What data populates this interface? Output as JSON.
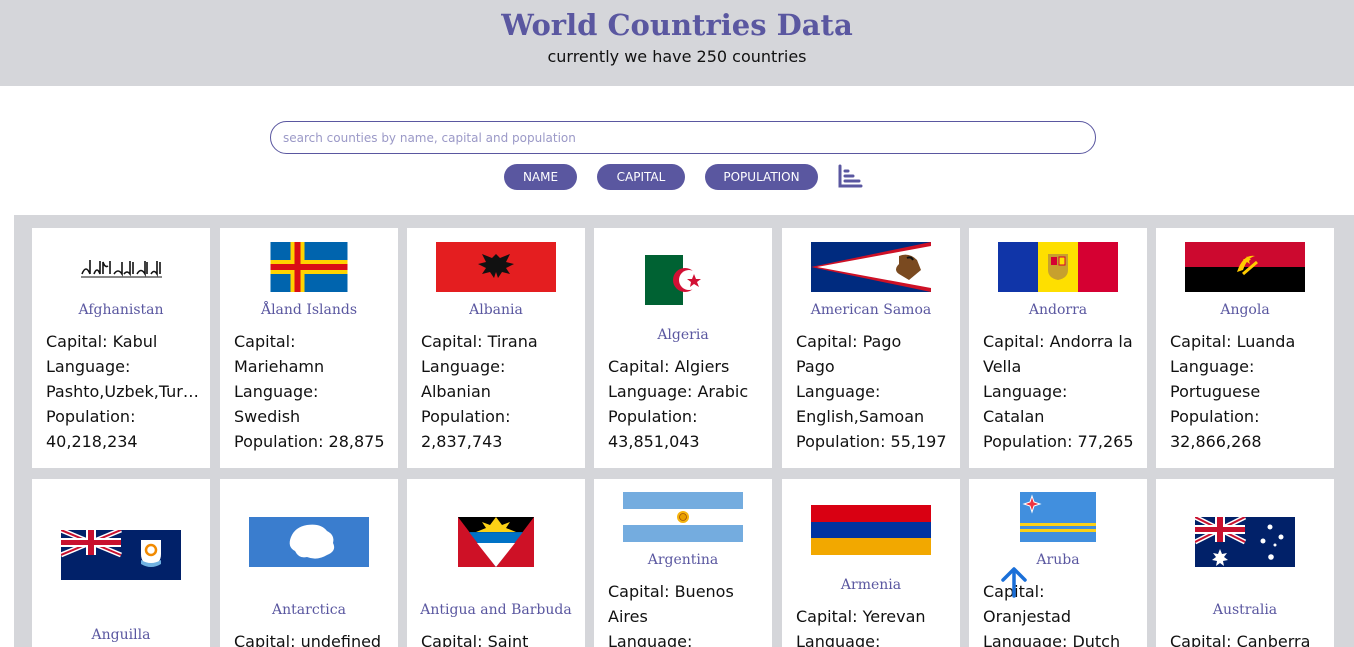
{
  "header": {
    "title": "World Countries Data",
    "subtitle": "currently we have 250 countries"
  },
  "search": {
    "placeholder": "search counties by name, capital and population",
    "value": ""
  },
  "sort_buttons": {
    "name": "NAME",
    "capital": "CAPITAL",
    "population": "POPULATION"
  },
  "icons": {
    "sort": "sort-bars-icon",
    "scroll_up": "arrow-up-icon"
  },
  "colors": {
    "accent": "#5a57a0",
    "header_bg": "#d5d6da",
    "scroll_arrow": "#1a6fd8"
  },
  "countries": [
    {
      "name": "Afghanistan",
      "capital_line": "Capital: Kabul",
      "language_label": "Language:",
      "language_value": "Pashto,Uzbek,Tur…",
      "population_label": "Population:",
      "population_value": "40,218,234"
    },
    {
      "name": "Åland Islands",
      "capital_label": "Capital:",
      "capital_value": "Mariehamn",
      "language_label": "Language:",
      "language_value": "Swedish",
      "population_line": "Population: 28,875"
    },
    {
      "name": "Albania",
      "capital_line": "Capital: Tirana",
      "language_label": "Language:",
      "language_value": "Albanian",
      "population_label": "Population:",
      "population_value": "2,837,743"
    },
    {
      "name": "Algeria",
      "capital_line": "Capital: Algiers",
      "language_line": "Language: Arabic",
      "population_label": "Population:",
      "population_value": "43,851,043"
    },
    {
      "name": "American Samoa",
      "capital_label": "Capital: Pago",
      "capital_value": "Pago",
      "language_label": "Language:",
      "language_value": "English,Samoan",
      "population_line": "Population: 55,197"
    },
    {
      "name": "Andorra",
      "capital_label": "Capital: Andorra la",
      "capital_value": "Vella",
      "language_label": "Language:",
      "language_value": "Catalan",
      "population_line": "Population: 77,265"
    },
    {
      "name": "Angola",
      "capital_line": "Capital: Luanda",
      "language_label": "Language:",
      "language_value": "Portuguese",
      "population_label": "Population:",
      "population_value": "32,866,268"
    },
    {
      "name": "Anguilla"
    },
    {
      "name": "Antarctica",
      "capital_line": "Capital: undefined"
    },
    {
      "name": "Antigua and Barbuda",
      "capital_line": "Capital: Saint"
    },
    {
      "name": "Argentina",
      "capital_label": "Capital: Buenos",
      "capital_value": "Aires",
      "language_label": "Language:"
    },
    {
      "name": "Armenia",
      "capital_line": "Capital: Yerevan",
      "language_label": "Language:"
    },
    {
      "name": "Aruba",
      "capital_label": "Capital:",
      "capital_value": "Oranjestad",
      "language_line": "Language: Dutch"
    },
    {
      "name": "Australia",
      "capital_line": "Capital: Canberra"
    }
  ]
}
